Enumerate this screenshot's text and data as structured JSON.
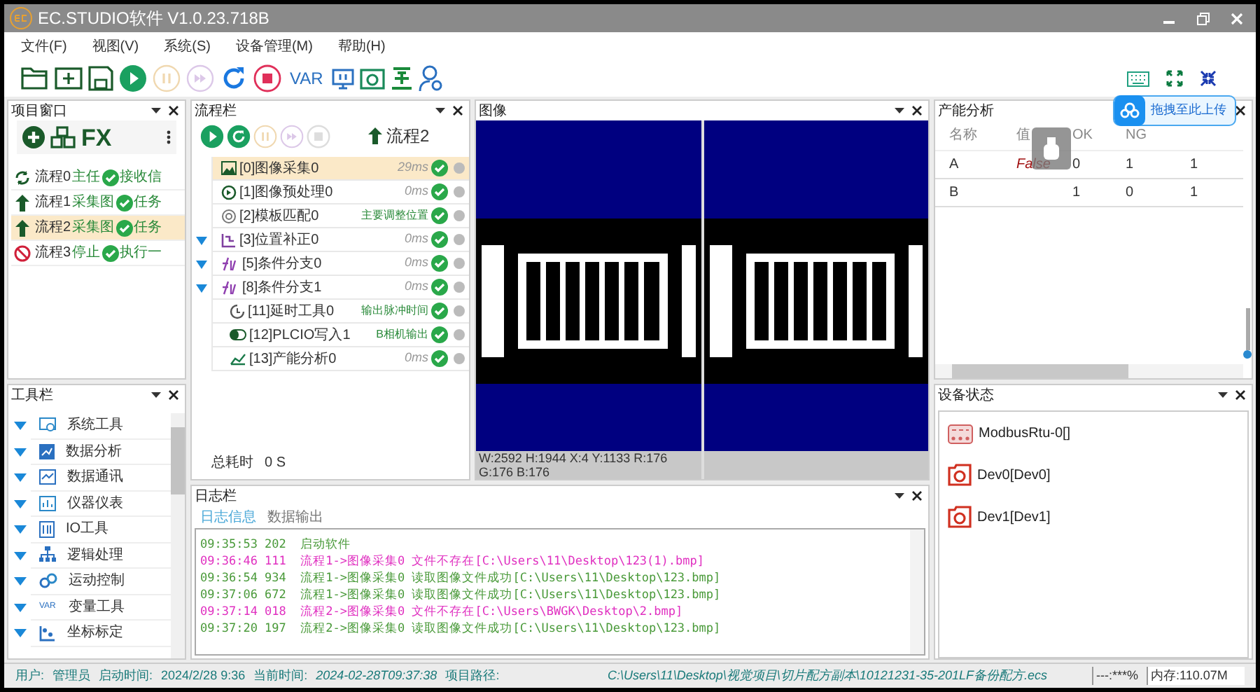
{
  "window": {
    "title": "EC.STUDIO软件 V1.0.23.718B"
  },
  "menu": [
    "文件(F)",
    "视图(V)",
    "系统(S)",
    "设备管理(M)",
    "帮助(H)"
  ],
  "toolbar": [
    {
      "disabled": false
    },
    {
      "disabled": false
    },
    {
      "disabled": false
    },
    {
      "disabled": false
    },
    {
      "disabled": true
    },
    {
      "disabled": true
    },
    {
      "disabled": false
    },
    {
      "disabled": false
    },
    {
      "disabled": false,
      "label": "VAR"
    },
    {
      "disabled": false
    },
    {
      "disabled": false
    },
    {
      "disabled": false
    },
    {
      "disabled": false
    }
  ],
  "project_panel": {
    "title": "项目窗口",
    "fx_label": "FX",
    "items": [
      {
        "label": "流程0",
        "kind": "loop",
        "note": "主任",
        "check": true,
        "note_after": "接收信",
        "selected": false
      },
      {
        "label": "流程1",
        "kind": "arrow",
        "note": "采集图",
        "check": true,
        "note_after": "任务",
        "selected": false
      },
      {
        "label": "流程2",
        "kind": "arrow",
        "note": "采集图",
        "check": true,
        "note_after": "任务",
        "selected": true
      },
      {
        "label": "流程3",
        "kind": "stop",
        "note": "停止",
        "check": true,
        "note_after": "执行一",
        "selected": false
      }
    ]
  },
  "flow_panel": {
    "title": "流程栏",
    "buttons": [
      {
        "disabled": false
      },
      {
        "disabled": false
      },
      {
        "disabled": true
      },
      {
        "disabled": true
      },
      {
        "disabled": true
      }
    ],
    "current_flow": "流程2",
    "items": [
      {
        "label": "[0]图像采集0",
        "kind": "image",
        "time": "29ms",
        "selected": true
      },
      {
        "label": "[1]图像预处理0",
        "kind": "preprocess",
        "time": "0ms",
        "selected": false
      },
      {
        "label": "[2]模板匹配0",
        "kind": "match",
        "note": "主要调整位置",
        "selected": false
      },
      {
        "label": "[3]位置补正0",
        "kind": "position",
        "time": "0ms",
        "expanded": true,
        "selected": false
      },
      {
        "label": "[5]条件分支0",
        "kind": "branch",
        "time": "0ms",
        "expanded": true,
        "selected": false
      },
      {
        "label": "[8]条件分支1",
        "kind": "branch",
        "time": "0ms",
        "expanded": true,
        "selected": false,
        "children": [
          {
            "label": "[11]延时工具0",
            "kind": "delay",
            "note": "输出脉冲时间",
            "selected": false
          },
          {
            "label": "[12]PLCIO写入1",
            "kind": "plc",
            "note": "B相机输出",
            "selected": false
          },
          {
            "label": "[13]产能分析0",
            "kind": "chart",
            "time": "0ms",
            "selected": false
          }
        ]
      }
    ],
    "total_label": "总耗时",
    "total_value": "0 S"
  },
  "image_panel": {
    "title": "图像",
    "status_line1": "W:2592 H:1944 X:4 Y:1133 R:176",
    "status_line2": "G:176 B:176"
  },
  "tool_panel": {
    "title": "工具栏",
    "items": [
      {
        "label": "系统工具",
        "expanded": true
      },
      {
        "label": "数据分析",
        "expanded": true
      },
      {
        "label": "数据通讯",
        "expanded": true
      },
      {
        "label": "仪器仪表",
        "expanded": true
      },
      {
        "label": "IO工具",
        "expanded": true
      },
      {
        "label": "逻辑处理",
        "expanded": true
      },
      {
        "label": "运动控制",
        "expanded": true
      },
      {
        "label": "变量工具",
        "expanded": true,
        "icon_text": "VAR"
      },
      {
        "label": "坐标标定",
        "expanded": true
      }
    ]
  },
  "log_panel": {
    "title": "日志栏",
    "tabs": [
      {
        "label": "日志信息",
        "selected": true
      },
      {
        "label": "数据输出",
        "selected": false
      }
    ],
    "lines": [
      {
        "kind": "info",
        "text": "09:35:53 202  启动软件"
      },
      {
        "kind": "error",
        "text": "09:36:46 111  流程1->图像采集0 文件不存在[C:\\Users\\11\\Desktop\\123(1).bmp]"
      },
      {
        "kind": "info",
        "text": "09:36:54 934  流程1->图像采集0 读取图像文件成功[C:\\Users\\11\\Desktop\\123.bmp]"
      },
      {
        "kind": "info",
        "text": "09:37:06 672  流程1->图像采集0 读取图像文件成功[C:\\Users\\11\\Desktop\\123.bmp]"
      },
      {
        "kind": "error",
        "text": "09:37:14 018  流程2->图像采集0 文件不存在[C:\\Users\\BWGK\\Desktop\\2.bmp]"
      },
      {
        "kind": "info",
        "text": "09:37:20 197  流程2->图像采集0 读取图像文件成功[C:\\Users\\11\\Desktop\\123.bmp]"
      }
    ]
  },
  "capacity_panel": {
    "title": "产能分析",
    "columns": [
      "名称",
      "值",
      "OK",
      "NG"
    ],
    "rows": [
      [
        "A",
        "False",
        "0",
        "1",
        "1"
      ],
      [
        "B",
        "",
        "1",
        "0",
        "1"
      ]
    ]
  },
  "upload_widget": {
    "label": "拖拽至此上传"
  },
  "device_panel": {
    "title": "设备状态",
    "items": [
      {
        "label": "ModbusRtu-0[]",
        "kind": "plc"
      },
      {
        "label": "Dev0[Dev0]",
        "kind": "camera"
      },
      {
        "label": "Dev1[Dev1]",
        "kind": "camera"
      }
    ]
  },
  "status_bar": {
    "user_label": "用户:",
    "user": "管理员",
    "start_label": "启动时间:",
    "start": "2024/2/28 9:36",
    "now_label": "当前时间:",
    "now": "2024-02-28T09:37:38",
    "path_label": "项目路径:",
    "path": "C:\\Users\\11\\Desktop\\视觉项目\\切片配方副本\\10121231-35-201LF备份配方.ecs",
    "cpu": "---:***%",
    "memory": "内存:110.07M"
  }
}
